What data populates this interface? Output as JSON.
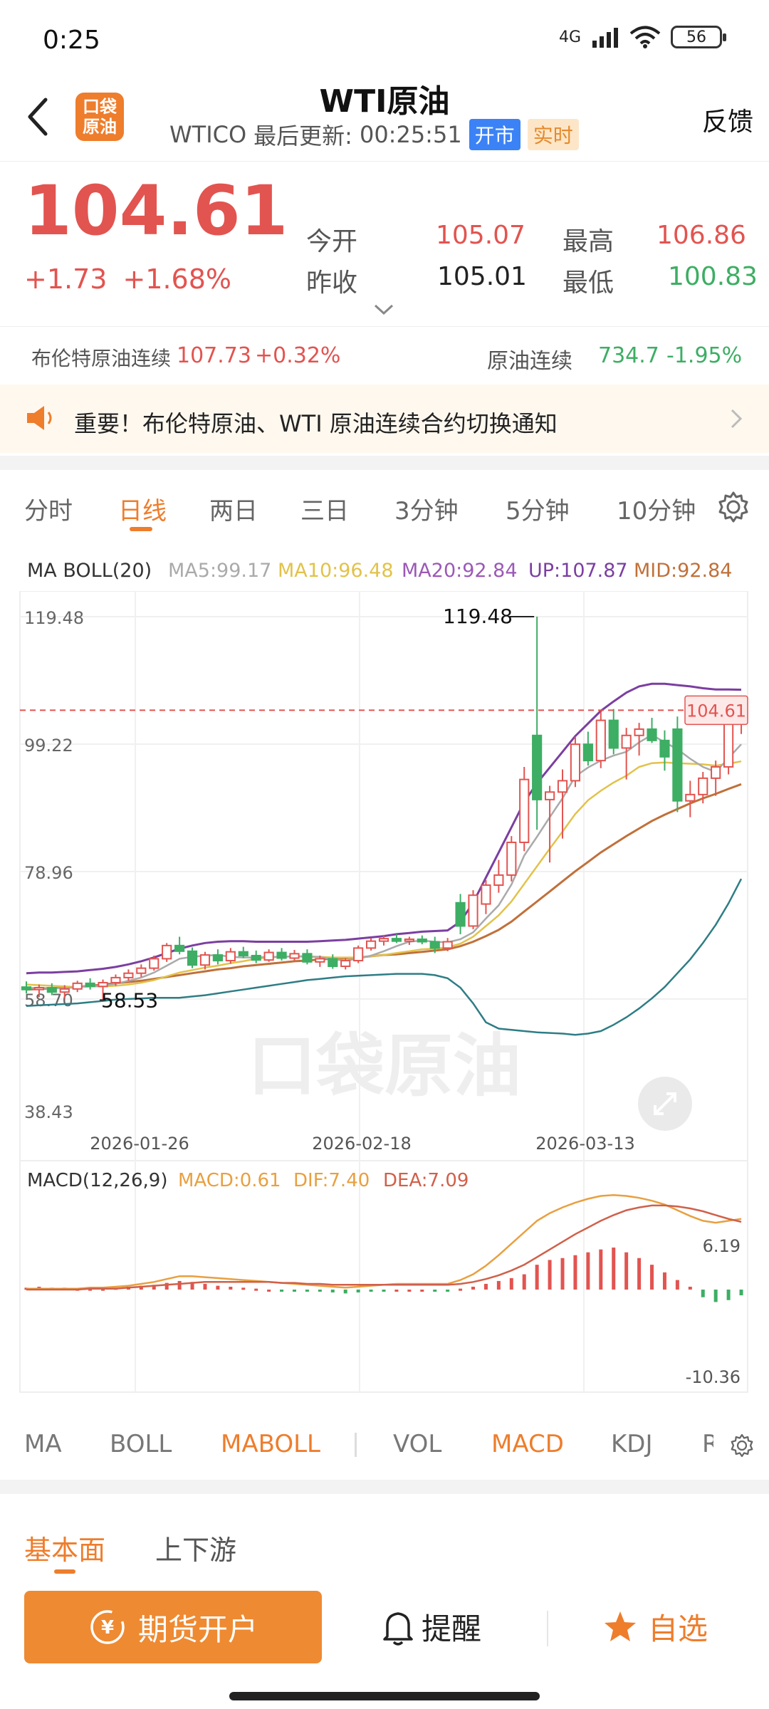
{
  "status_bar": {
    "time": "0:25",
    "network": "4G",
    "battery": "56"
  },
  "header": {
    "title": "WTI原油",
    "code": "WTICO",
    "updated_label": "最后更新:",
    "updated_time": "00:25:51",
    "badge_open": "开市",
    "badge_realtime": "实时",
    "feedback": "反馈",
    "logo_text_top": "口袋",
    "logo_text_bottom": "原油"
  },
  "quote": {
    "price": "104.61",
    "change": "+1.73",
    "change_pct": "+1.68%",
    "open_label": "今开",
    "open": "105.07",
    "prev_close_label": "昨收",
    "prev_close": "105.01",
    "high_label": "最高",
    "high": "106.86",
    "low_label": "最低",
    "low": "100.83"
  },
  "related": {
    "brent_label": "布伦特原油连续",
    "brent_value": "107.73",
    "brent_change": "+0.32%",
    "crude_label": "原油连续",
    "crude_value": "734.7",
    "crude_change": "-1.95%"
  },
  "notice": {
    "text": "重要！布伦特原油、WTI 原油连续合约切换通知"
  },
  "kline_tabs": [
    "分时",
    "日线",
    "两日",
    "三日",
    "3分钟",
    "5分钟",
    "10分钟"
  ],
  "kline_active": "日线",
  "legend": {
    "name": "MA BOLL(20)",
    "ma5": "MA5:99.17",
    "ma10": "MA10:96.48",
    "ma20": "MA20:92.84",
    "up": "UP:107.87",
    "mid": "MID:92.84"
  },
  "colors": {
    "accent": "#ee7d2c",
    "up": "#e25450",
    "down": "#3dae64",
    "ma5": "#aaaaaa",
    "ma10": "#e2c24a",
    "ma20": "#8e44ad",
    "boll_up": "#7b3fa0",
    "boll_mid": "#c0703a",
    "boll_low": "#2e7d85",
    "macd_line": "#e8a040",
    "dif": "#e8a040",
    "dea": "#d0604a"
  },
  "price_axis": {
    "top": "119.48",
    "mid": "99.22",
    "low": "78.96",
    "bottom": "38.43",
    "partial": "58.70"
  },
  "annotations": {
    "max": "119.48",
    "min": "58.53",
    "current": "104.61",
    "watermark": "口袋原油"
  },
  "dates": [
    "2026-01-26",
    "2026-02-18",
    "2026-03-13"
  ],
  "macd": {
    "name": "MACD(12,26,9)",
    "macd": "MACD:0.61",
    "dif": "DIF:7.40",
    "dea": "DEA:7.09",
    "axis_top": "6.19",
    "axis_bottom": "-10.36"
  },
  "indicators": [
    "MA",
    "BOLL",
    "MABOLL",
    "VOL",
    "MACD",
    "KDJ",
    "R"
  ],
  "indicators_active": [
    "MABOLL",
    "MACD"
  ],
  "sub_tabs": [
    "基本面",
    "上下游"
  ],
  "bottom": {
    "open_account": "期货开户",
    "remind": "提醒",
    "favorite": "自选"
  },
  "chart_data": {
    "type": "candlestick",
    "title": "",
    "ylim": [
      38.43,
      119.48
    ],
    "candles": [
      {
        "o": 60.6,
        "h": 61.5,
        "l": 59.6,
        "c": 60.2
      },
      {
        "o": 60.2,
        "h": 61.0,
        "l": 59.0,
        "c": 60.5
      },
      {
        "o": 60.5,
        "h": 61.2,
        "l": 59.3,
        "c": 59.8
      },
      {
        "o": 59.8,
        "h": 60.9,
        "l": 58.8,
        "c": 60.3
      },
      {
        "o": 60.3,
        "h": 61.6,
        "l": 59.8,
        "c": 61.2
      },
      {
        "o": 61.2,
        "h": 62.0,
        "l": 60.2,
        "c": 60.7
      },
      {
        "o": 60.7,
        "h": 61.8,
        "l": 58.53,
        "c": 61.3
      },
      {
        "o": 61.3,
        "h": 62.6,
        "l": 60.8,
        "c": 62.1
      },
      {
        "o": 62.1,
        "h": 63.4,
        "l": 61.6,
        "c": 62.8
      },
      {
        "o": 62.8,
        "h": 64.2,
        "l": 62.2,
        "c": 63.6
      },
      {
        "o": 63.6,
        "h": 65.6,
        "l": 63.2,
        "c": 65.1
      },
      {
        "o": 65.1,
        "h": 67.6,
        "l": 64.6,
        "c": 67.2
      },
      {
        "o": 67.2,
        "h": 68.6,
        "l": 65.8,
        "c": 66.3
      },
      {
        "o": 66.3,
        "h": 66.9,
        "l": 63.6,
        "c": 64.1
      },
      {
        "o": 64.1,
        "h": 66.2,
        "l": 63.4,
        "c": 65.7
      },
      {
        "o": 65.7,
        "h": 66.6,
        "l": 64.2,
        "c": 64.8
      },
      {
        "o": 64.8,
        "h": 66.8,
        "l": 64.3,
        "c": 66.2
      },
      {
        "o": 66.2,
        "h": 67.0,
        "l": 65.2,
        "c": 65.6
      },
      {
        "o": 65.6,
        "h": 66.4,
        "l": 64.4,
        "c": 64.9
      },
      {
        "o": 64.9,
        "h": 66.6,
        "l": 64.6,
        "c": 66.1
      },
      {
        "o": 66.1,
        "h": 66.8,
        "l": 64.8,
        "c": 65.2
      },
      {
        "o": 65.2,
        "h": 66.5,
        "l": 64.8,
        "c": 65.9
      },
      {
        "o": 65.9,
        "h": 66.6,
        "l": 64.2,
        "c": 64.6
      },
      {
        "o": 64.6,
        "h": 65.6,
        "l": 63.8,
        "c": 65.1
      },
      {
        "o": 65.1,
        "h": 65.8,
        "l": 63.5,
        "c": 63.9
      },
      {
        "o": 63.9,
        "h": 65.2,
        "l": 63.4,
        "c": 64.8
      },
      {
        "o": 64.8,
        "h": 67.2,
        "l": 64.4,
        "c": 66.8
      },
      {
        "o": 66.8,
        "h": 68.4,
        "l": 66.4,
        "c": 67.9
      },
      {
        "o": 67.9,
        "h": 68.9,
        "l": 67.2,
        "c": 68.3
      },
      {
        "o": 68.3,
        "h": 69.0,
        "l": 67.6,
        "c": 67.9
      },
      {
        "o": 67.9,
        "h": 68.6,
        "l": 67.3,
        "c": 68.2
      },
      {
        "o": 68.2,
        "h": 68.8,
        "l": 67.4,
        "c": 67.8
      },
      {
        "o": 67.8,
        "h": 68.6,
        "l": 66.0,
        "c": 66.8
      },
      {
        "o": 66.8,
        "h": 68.4,
        "l": 66.3,
        "c": 67.8
      },
      {
        "o": 74.0,
        "h": 75.4,
        "l": 69.0,
        "c": 70.3
      },
      {
        "o": 70.3,
        "h": 76.0,
        "l": 69.8,
        "c": 75.2
      },
      {
        "o": 73.8,
        "h": 77.6,
        "l": 72.2,
        "c": 76.8
      },
      {
        "o": 76.8,
        "h": 80.8,
        "l": 75.6,
        "c": 78.4
      },
      {
        "o": 78.4,
        "h": 84.6,
        "l": 77.4,
        "c": 83.6
      },
      {
        "o": 83.6,
        "h": 95.6,
        "l": 82.2,
        "c": 93.6
      },
      {
        "o": 100.6,
        "h": 119.48,
        "l": 85.6,
        "c": 90.4
      },
      {
        "o": 90.4,
        "h": 92.6,
        "l": 80.4,
        "c": 91.6
      },
      {
        "o": 91.6,
        "h": 95.2,
        "l": 84.2,
        "c": 93.4
      },
      {
        "o": 93.4,
        "h": 100.4,
        "l": 92.4,
        "c": 99.2
      },
      {
        "o": 99.2,
        "h": 101.2,
        "l": 95.8,
        "c": 96.6
      },
      {
        "o": 96.6,
        "h": 104.4,
        "l": 95.4,
        "c": 103.0
      },
      {
        "o": 103.0,
        "h": 104.8,
        "l": 97.6,
        "c": 98.6
      },
      {
        "o": 98.6,
        "h": 101.8,
        "l": 93.6,
        "c": 100.6
      },
      {
        "o": 100.6,
        "h": 102.6,
        "l": 97.4,
        "c": 101.6
      },
      {
        "o": 101.6,
        "h": 103.4,
        "l": 99.4,
        "c": 99.8
      },
      {
        "o": 99.8,
        "h": 101.4,
        "l": 95.0,
        "c": 97.2
      },
      {
        "o": 101.6,
        "h": 103.6,
        "l": 88.4,
        "c": 90.2
      },
      {
        "o": 90.2,
        "h": 93.4,
        "l": 87.6,
        "c": 91.2
      },
      {
        "o": 91.2,
        "h": 94.8,
        "l": 89.8,
        "c": 93.8
      },
      {
        "o": 93.8,
        "h": 96.6,
        "l": 91.0,
        "c": 95.6
      },
      {
        "o": 95.6,
        "h": 104.2,
        "l": 94.4,
        "c": 103.2
      },
      {
        "o": 103.2,
        "h": 106.86,
        "l": 100.83,
        "c": 104.61
      }
    ],
    "ma5": [
      60.4,
      60.5,
      60.4,
      60.4,
      60.6,
      60.7,
      60.8,
      61.1,
      61.6,
      62.1,
      62.9,
      64.0,
      65.1,
      65.4,
      65.6,
      65.7,
      65.4,
      65.3,
      65.3,
      65.4,
      65.4,
      65.5,
      65.4,
      65.4,
      65.0,
      64.8,
      65.1,
      65.6,
      66.3,
      67.1,
      67.8,
      68.0,
      67.8,
      67.7,
      68.2,
      69.3,
      71.5,
      73.6,
      76.9,
      81.5,
      84.5,
      87.6,
      90.6,
      94.1,
      95.5,
      96.6,
      97.4,
      98.0,
      99.5,
      100.7,
      99.5,
      98.4,
      96.9,
      95.6,
      94.8,
      97.0,
      99.2
    ],
    "ma10": [
      61.0,
      60.9,
      60.8,
      60.7,
      60.6,
      60.7,
      60.7,
      60.8,
      61.0,
      61.3,
      61.7,
      62.3,
      62.9,
      63.3,
      63.7,
      64.0,
      64.4,
      64.7,
      65.1,
      65.3,
      65.4,
      65.5,
      65.5,
      65.4,
      65.3,
      65.3,
      65.3,
      65.5,
      65.7,
      66.0,
      66.3,
      66.6,
      66.7,
      66.9,
      67.5,
      68.6,
      70.3,
      72.0,
      74.2,
      77.0,
      79.8,
      82.6,
      85.3,
      88.1,
      90.3,
      91.8,
      93.1,
      94.2,
      95.6,
      96.2,
      96.3,
      96.2,
      96.1,
      96.0,
      95.8,
      96.1,
      96.48
    ],
    "boll_up": [
      62.8,
      62.9,
      62.9,
      63.0,
      63.1,
      63.3,
      63.5,
      63.8,
      64.2,
      64.7,
      65.3,
      66.0,
      66.7,
      67.2,
      67.6,
      67.8,
      67.9,
      67.9,
      67.8,
      67.8,
      67.8,
      67.8,
      67.8,
      67.9,
      68.0,
      68.1,
      68.3,
      68.5,
      68.7,
      69.0,
      69.2,
      69.4,
      69.5,
      69.6,
      71.0,
      74.0,
      78.0,
      82.0,
      86.0,
      90.0,
      93.0,
      95.5,
      98.0,
      100.5,
      102.5,
      104.5,
      106.0,
      107.4,
      108.4,
      108.8,
      108.8,
      108.6,
      108.4,
      108.1,
      107.9,
      107.9,
      107.87
    ],
    "boll_mid": [
      60.2,
      60.3,
      60.4,
      60.5,
      60.6,
      60.8,
      61.0,
      61.2,
      61.4,
      61.6,
      61.9,
      62.2,
      62.5,
      62.8,
      63.1,
      63.4,
      63.6,
      63.9,
      64.1,
      64.3,
      64.5,
      64.7,
      64.8,
      65.0,
      65.1,
      65.2,
      65.3,
      65.5,
      65.7,
      65.8,
      66.0,
      66.2,
      66.4,
      66.6,
      67.1,
      67.8,
      68.7,
      69.7,
      71.0,
      72.6,
      74.2,
      75.8,
      77.4,
      79.0,
      80.5,
      82.0,
      83.3,
      84.6,
      85.8,
      87.0,
      88.0,
      88.9,
      89.8,
      90.6,
      91.3,
      92.1,
      92.84
    ],
    "boll_low": [
      57.6,
      57.7,
      57.8,
      57.9,
      58.0,
      58.2,
      58.4,
      58.6,
      58.7,
      58.8,
      58.9,
      58.9,
      58.9,
      59.1,
      59.3,
      59.6,
      59.9,
      60.2,
      60.5,
      60.8,
      61.1,
      61.4,
      61.7,
      61.9,
      62.1,
      62.3,
      62.4,
      62.5,
      62.6,
      62.7,
      62.7,
      62.7,
      62.5,
      62.0,
      60.5,
      58.0,
      55.0,
      54.0,
      53.8,
      53.6,
      53.4,
      53.3,
      53.2,
      53.0,
      53.2,
      53.6,
      54.6,
      55.8,
      57.2,
      58.8,
      60.6,
      62.8,
      65.0,
      67.6,
      70.5,
      73.9,
      77.8
    ]
  },
  "macd_data": {
    "ylim": [
      -10.36,
      6.19
    ],
    "hist": [
      0.2,
      0.3,
      0.2,
      0.2,
      0.1,
      0.1,
      0.1,
      0.2,
      0.3,
      0.4,
      0.5,
      0.7,
      0.9,
      0.8,
      0.6,
      0.4,
      0.3,
      0.2,
      0.1,
      0.0,
      -0.1,
      -0.1,
      -0.1,
      -0.2,
      -0.3,
      -0.4,
      -0.3,
      -0.2,
      -0.1,
      0.0,
      0.0,
      0.0,
      -0.1,
      -0.1,
      0.1,
      0.3,
      0.6,
      0.9,
      1.2,
      1.6,
      2.6,
      3.1,
      3.3,
      3.6,
      3.9,
      4.2,
      4.4,
      3.9,
      3.3,
      2.6,
      1.8,
      1.0,
      0.3,
      -0.8,
      -1.3,
      -1.1,
      -0.6
    ],
    "dif": [
      0.1,
      0.1,
      0.1,
      0.1,
      0.1,
      0.2,
      0.2,
      0.3,
      0.4,
      0.6,
      0.8,
      1.1,
      1.4,
      1.4,
      1.3,
      1.2,
      1.1,
      1.0,
      0.9,
      0.8,
      0.7,
      0.6,
      0.5,
      0.4,
      0.3,
      0.2,
      0.3,
      0.4,
      0.5,
      0.6,
      0.6,
      0.6,
      0.6,
      0.6,
      1.0,
      1.6,
      2.5,
      3.6,
      4.8,
      6.0,
      7.2,
      8.0,
      8.6,
      9.1,
      9.5,
      9.8,
      9.9,
      9.8,
      9.6,
      9.3,
      8.9,
      8.3,
      7.7,
      7.2,
      7.0,
      7.2,
      7.4
    ],
    "dea": [
      0.0,
      0.0,
      0.0,
      0.0,
      0.0,
      0.1,
      0.1,
      0.1,
      0.2,
      0.3,
      0.4,
      0.5,
      0.6,
      0.7,
      0.8,
      0.8,
      0.8,
      0.8,
      0.8,
      0.8,
      0.7,
      0.7,
      0.6,
      0.6,
      0.5,
      0.5,
      0.5,
      0.5,
      0.5,
      0.5,
      0.5,
      0.5,
      0.5,
      0.5,
      0.6,
      0.8,
      1.1,
      1.5,
      2.0,
      2.6,
      3.4,
      4.2,
      5.0,
      5.8,
      6.5,
      7.2,
      7.8,
      8.3,
      8.6,
      8.8,
      8.8,
      8.7,
      8.5,
      8.2,
      7.8,
      7.4,
      7.09
    ]
  }
}
